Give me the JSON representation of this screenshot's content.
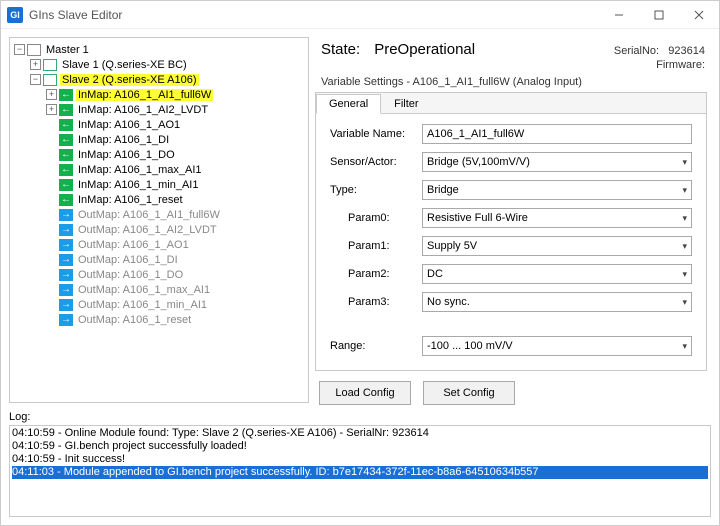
{
  "window": {
    "title": "GIns Slave Editor",
    "app_icon_text": "GI"
  },
  "tree": {
    "master": "Master 1",
    "slave1": "Slave 1 (Q.series-XE BC)",
    "slave2": "Slave 2 (Q.series-XE A106)",
    "in_items": [
      "InMap: A106_1_AI1_full6W",
      "InMap: A106_1_AI2_LVDT",
      "InMap: A106_1_AO1",
      "InMap: A106_1_DI",
      "InMap: A106_1_DO",
      "InMap: A106_1_max_AI1",
      "InMap: A106_1_min_AI1",
      "InMap: A106_1_reset"
    ],
    "out_items": [
      "OutMap: A106_1_AI1_full6W",
      "OutMap: A106_1_AI2_LVDT",
      "OutMap: A106_1_AO1",
      "OutMap: A106_1_DI",
      "OutMap: A106_1_DO",
      "OutMap: A106_1_max_AI1",
      "OutMap: A106_1_min_AI1",
      "OutMap: A106_1_reset"
    ]
  },
  "state": {
    "label": "State:",
    "value": "PreOperational",
    "serial_label": "SerialNo:",
    "serial_value": "923614",
    "firmware_label": "Firmware:"
  },
  "settings": {
    "caption": "Variable Settings - A106_1_AI1_full6W (Analog Input)",
    "tabs": {
      "general": "General",
      "filter": "Filter"
    },
    "fields": {
      "var_name_label": "Variable Name:",
      "var_name_value": "A106_1_AI1_full6W",
      "sensor_label": "Sensor/Actor:",
      "sensor_value": "Bridge (5V,100mV/V)",
      "type_label": "Type:",
      "type_value": "Bridge",
      "param0_label": "Param0:",
      "param0_value": "Resistive Full 6-Wire",
      "param1_label": "Param1:",
      "param1_value": "Supply 5V",
      "param2_label": "Param2:",
      "param2_value": "DC",
      "param3_label": "Param3:",
      "param3_value": "No sync.",
      "range_label": "Range:",
      "range_value": "-100 ... 100 mV/V"
    },
    "buttons": {
      "load": "Load Config",
      "set": "Set Config"
    }
  },
  "log": {
    "label": "Log:",
    "lines": [
      "04:10:59 - Online Module found: Type: Slave 2 (Q.series-XE A106) - SerialNr: 923614",
      "04:10:59 - GI.bench project successfully loaded!",
      "04:10:59 - Init success!",
      "04:11:03 - Module appended to GI.bench project successfully. ID: b7e17434-372f-11ec-b8a6-64510634b557"
    ]
  }
}
